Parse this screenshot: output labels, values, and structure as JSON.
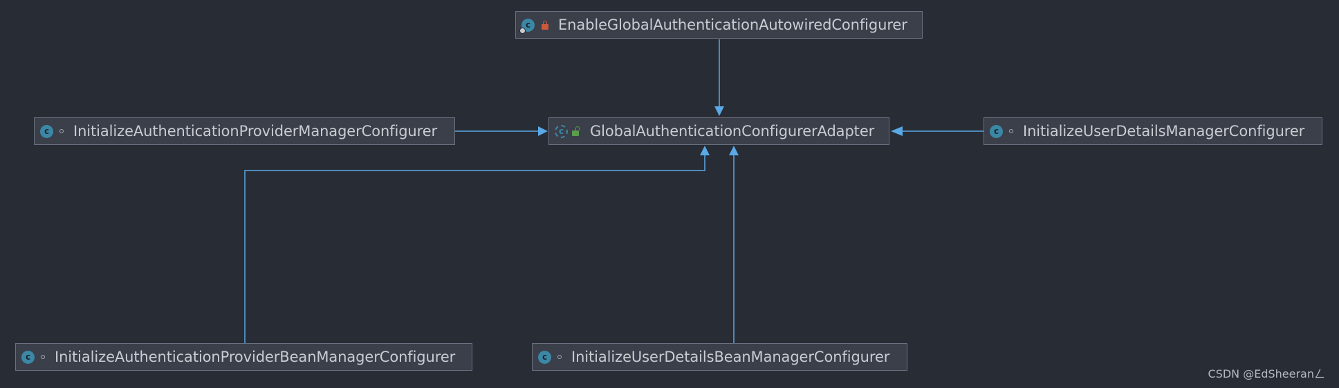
{
  "diagram": {
    "nodes": [
      {
        "id": "enable",
        "label": "EnableGlobalAuthenticationAutowiredConfigurer",
        "icon": "class-with-badge-icon",
        "visibility": "private-lock-icon"
      },
      {
        "id": "adapter",
        "label": "GlobalAuthenticationConfigurerAdapter",
        "icon": "abstract-class-icon",
        "visibility": "public-open-lock-icon"
      },
      {
        "id": "provider",
        "label": "InitializeAuthenticationProviderManagerConfigurer",
        "icon": "class-icon",
        "visibility": "package-private-icon"
      },
      {
        "id": "userdetails",
        "label": "InitializeUserDetailsManagerConfigurer",
        "icon": "class-icon",
        "visibility": "package-private-icon"
      },
      {
        "id": "providerbean",
        "label": "InitializeAuthenticationProviderBeanManagerConfigurer",
        "icon": "class-icon",
        "visibility": "package-private-icon"
      },
      {
        "id": "userdetailsbean",
        "label": "InitializeUserDetailsBeanManagerConfigurer",
        "icon": "class-icon",
        "visibility": "package-private-icon"
      }
    ],
    "edges": [
      {
        "from": "enable",
        "to": "adapter",
        "type": "extends"
      },
      {
        "from": "provider",
        "to": "adapter",
        "type": "extends"
      },
      {
        "from": "userdetails",
        "to": "adapter",
        "type": "extends"
      },
      {
        "from": "providerbean",
        "to": "adapter",
        "type": "extends"
      },
      {
        "from": "userdetailsbean",
        "to": "adapter",
        "type": "extends"
      }
    ]
  },
  "colors": {
    "background": "#282c35",
    "node_fill": "#3a3f4a",
    "node_border": "#6a7180",
    "edge": "#5aa9e6",
    "text": "#c9ccd2"
  },
  "watermark": "CSDN @EdSheeranㄥ"
}
